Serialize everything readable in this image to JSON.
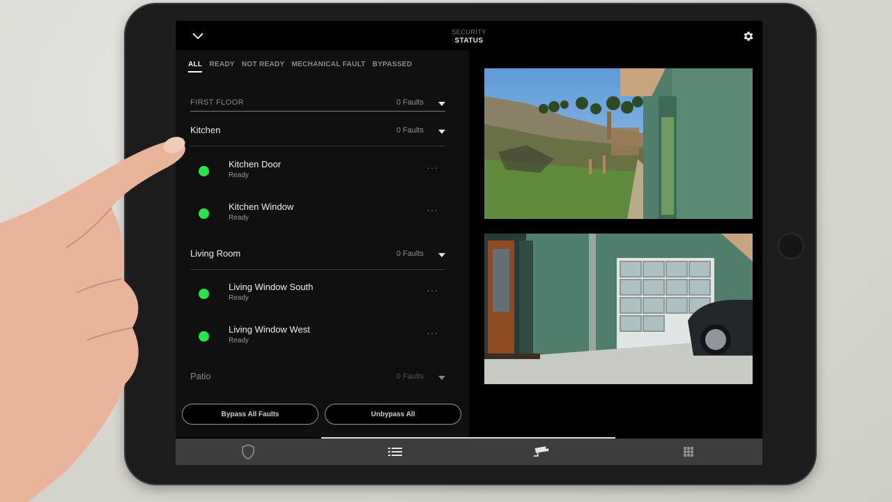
{
  "header": {
    "title_small": "SECURITY",
    "title_main": "STATUS",
    "back_icon": "chevron-down-icon",
    "settings_icon": "gear-icon"
  },
  "filters": [
    {
      "label": "ALL",
      "active": true
    },
    {
      "label": "READY",
      "active": false
    },
    {
      "label": "NOT READY",
      "active": false
    },
    {
      "label": "MECHANICAL FAULT",
      "active": false
    },
    {
      "label": "BYPASSED",
      "active": false
    }
  ],
  "floor": {
    "label": "FIRST FLOOR",
    "faults": "0 Faults"
  },
  "rooms": [
    {
      "name": "Kitchen",
      "faults": "0 Faults",
      "devices": [
        {
          "name": "Kitchen Door",
          "status": "Ready",
          "more": "···"
        },
        {
          "name": "Kitchen Window",
          "status": "Ready",
          "more": "···"
        }
      ]
    },
    {
      "name": "Living Room",
      "faults": "0 Faults",
      "devices": [
        {
          "name": "Living Window South",
          "status": "Ready",
          "more": "···"
        },
        {
          "name": "Living Window West",
          "status": "Ready",
          "more": "···"
        }
      ]
    },
    {
      "name": "Patio",
      "faults": "0 Faults",
      "devices": []
    }
  ],
  "actions": {
    "bypass_all": "Bypass All Faults",
    "unbypass_all": "Unbypass All"
  },
  "tabs": [
    {
      "icon": "shield-icon"
    },
    {
      "icon": "list-icon"
    },
    {
      "icon": "camera-icon"
    },
    {
      "icon": "grid-icon"
    }
  ],
  "colors": {
    "ready_dot": "#24e64a",
    "tab_bar": "#3b3e3d",
    "panel_bg": "#0f0f0f"
  }
}
